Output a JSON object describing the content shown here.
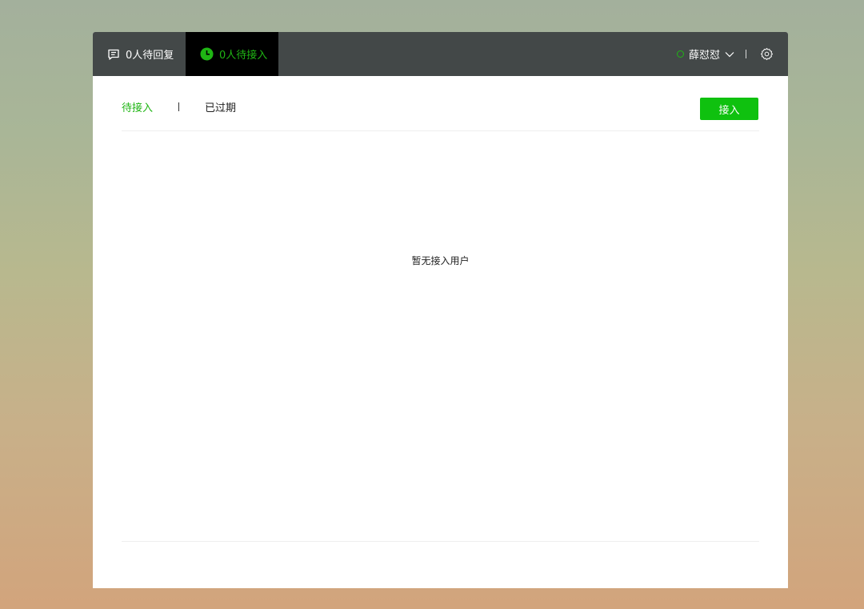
{
  "topbar": {
    "tabs": [
      {
        "label": "0人待回复",
        "icon": "chat-bubble-icon"
      },
      {
        "label": "0人待接入",
        "icon": "clock-icon",
        "active": true
      }
    ],
    "user": {
      "name": "薛怼怼",
      "status_color": "#1fb514"
    },
    "settings_icon": "gear-icon"
  },
  "subtabs": {
    "active": "待接入",
    "other": "已过期"
  },
  "actions": {
    "accept_label": "接入"
  },
  "main": {
    "empty_text": "暂无接入用户"
  },
  "colors": {
    "accent": "#0fc10f",
    "topbar": "#434848",
    "active_tab_bg": "#000000"
  }
}
